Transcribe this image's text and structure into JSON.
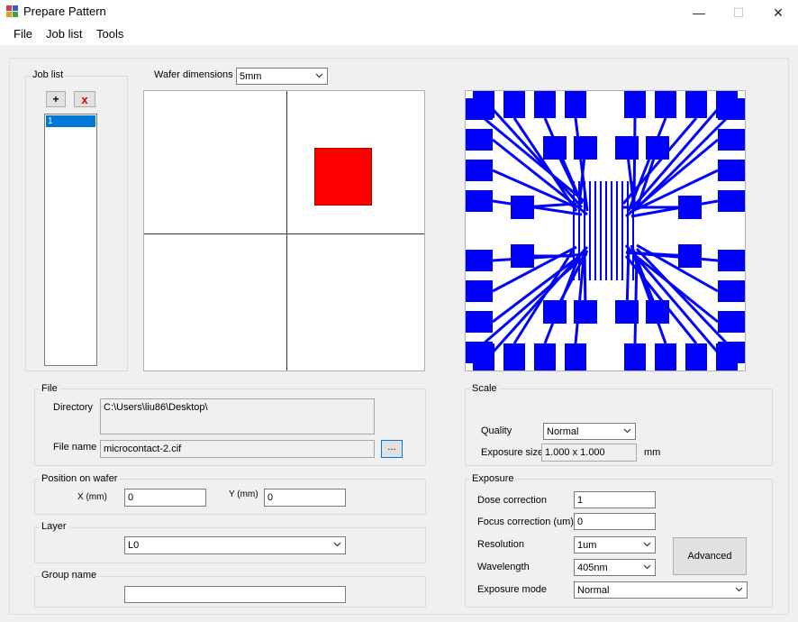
{
  "window": {
    "title": "Prepare Pattern",
    "minimize": "—",
    "maximize": "☐",
    "close": "✕"
  },
  "menu": [
    "File",
    "Job list",
    "Tools"
  ],
  "job_list": {
    "group_title": "Job list",
    "add_label": "+",
    "remove_label": "x",
    "items": [
      "1"
    ]
  },
  "wafer": {
    "label": "Wafer dimensions",
    "value": "5mm",
    "marker_color": "#ff0000"
  },
  "file": {
    "group_title": "File",
    "directory_label": "Directory",
    "directory_value": "C:\\Users\\liu86\\Desktop\\",
    "filename_label": "File name",
    "filename_value": "microcontact-2.cif",
    "browse_label": "..."
  },
  "position": {
    "group_title": "Position on wafer",
    "x_label": "X (mm)",
    "x_value": "0",
    "y_label": "Y (mm)",
    "y_value": "0"
  },
  "layer": {
    "group_title": "Layer",
    "value": "L0"
  },
  "group_name": {
    "group_title": "Group name",
    "value": ""
  },
  "scale": {
    "group_title": "Scale",
    "quality_label": "Quality",
    "quality_value": "Normal",
    "exposure_size_label": "Exposure size",
    "exposure_size_value": "1.000 x 1.000",
    "unit": "mm"
  },
  "exposure": {
    "group_title": "Exposure",
    "dose_label": "Dose correction",
    "dose_value": "1",
    "focus_label": "Focus correction (um)",
    "focus_value": "0",
    "resolution_label": "Resolution",
    "resolution_value": "1um",
    "wavelength_label": "Wavelength",
    "wavelength_value": "405nm",
    "mode_label": "Exposure mode",
    "mode_value": "Normal",
    "advanced_label": "Advanced"
  },
  "pattern_color": "#0000ff"
}
